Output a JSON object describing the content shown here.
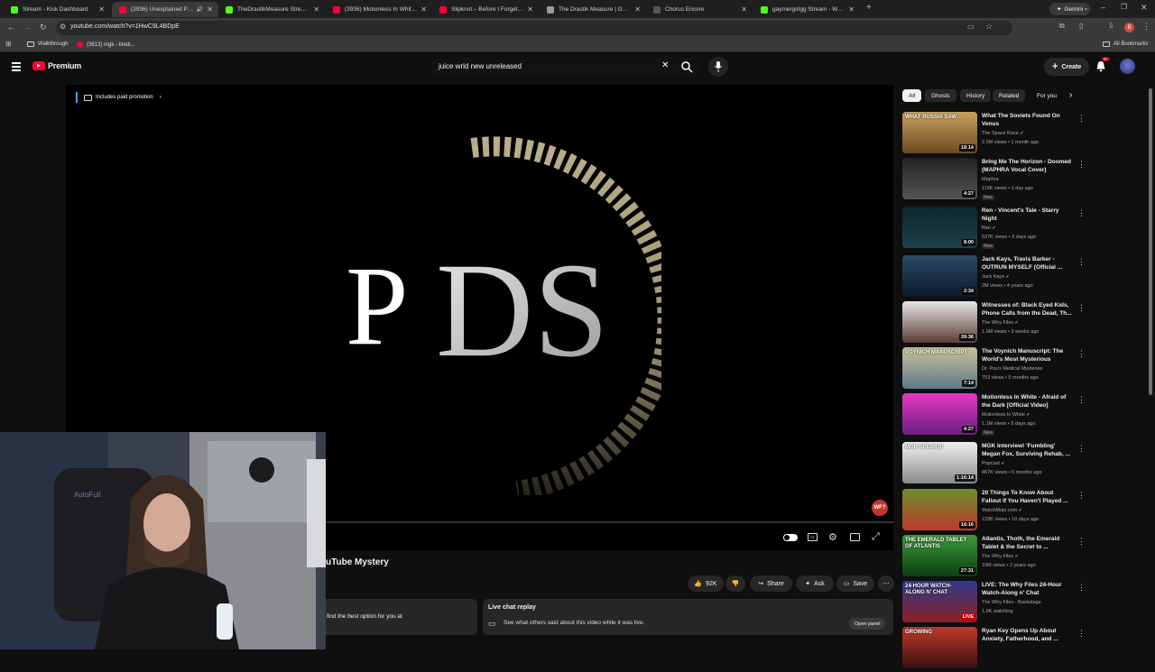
{
  "browser": {
    "tabs": [
      {
        "label": "Stream - Kick Dashboard",
        "color": "#53fc18"
      },
      {
        "label": "(3936) Unexplained Phenom",
        "color": "#ff0033",
        "active": true
      },
      {
        "label": "TheDrastikMeasure Stream - W",
        "color": "#53fc18"
      },
      {
        "label": "(3936) Motionless In White - Af",
        "color": "#ff0033"
      },
      {
        "label": "Slipknot – Before I Forget (Synt",
        "color": "#ff0033"
      },
      {
        "label": "The Drastik Measure | Gaming",
        "color": "#9a9a9a"
      },
      {
        "label": "Chorus Encore",
        "color": "#555555"
      },
      {
        "label": "gaymergirlgg Stream - Watch l",
        "color": "#53fc18"
      }
    ],
    "gemini_label": "Gemini",
    "url": "youtube.com/watch?v=1HwC9L4BDpE",
    "bookmarks": [
      {
        "label": "Walkthrough"
      },
      {
        "label": "(3813) mgk - tiredi..."
      }
    ],
    "all_bookmarks": "All Bookmarks",
    "profile_initial": "B"
  },
  "header": {
    "logo_text": "Premium",
    "search_value": "juice wrld new unreleased",
    "create_label": "Create",
    "notif_count": "9+"
  },
  "player": {
    "paid_promo": "Includes paid promotion",
    "logo_text": "PDS",
    "watermark": "WF?"
  },
  "video": {
    "title_fragment": "uTube Mystery",
    "like_count": "92K",
    "share_label": "Share",
    "ask_label": "Ask",
    "save_label": "Save",
    "promo_fragment": "find the best option for you at",
    "live_chat_title": "Live chat replay",
    "live_chat_desc": "See what others said about this video while it was live.",
    "open_panel": "Open panel"
  },
  "chips": [
    {
      "label": "All",
      "active": true
    },
    {
      "label": "Ghosts"
    },
    {
      "label": "History"
    },
    {
      "label": "Related"
    },
    {
      "label": "For you"
    }
  ],
  "recommendations": [
    {
      "title": "What The Soviets Found On Venus",
      "channel": "The Space Race",
      "meta": "2.3M views • 1 month ago",
      "duration": "18:14",
      "thumb_text": "WHAT RUSSIA SAW",
      "verified": true
    },
    {
      "title": "Bring Me The Horizon - Doomed (MAPHRA Vocal Cover)",
      "channel": "Maphra",
      "meta": "116K views • 1 day ago",
      "duration": "4:27",
      "new": "New"
    },
    {
      "title": "Ren - Vincent's Tale - Starry Night",
      "channel": "Ren",
      "meta": "537K views • 3 days ago",
      "duration": "8:00",
      "new": "New",
      "verified": true
    },
    {
      "title": "Jack Kays, Travis Barker - OUTRUN MYSELF (Official ...",
      "channel": "Jack Kays",
      "meta": "2M views • 4 years ago",
      "duration": "2:34",
      "verified": true
    },
    {
      "title": "Witnesses of: Black Eyed Kids, Phone Calls from the Dead, Th...",
      "channel": "The Why Files",
      "meta": "1.5M views • 3 weeks ago",
      "duration": "39:36",
      "verified": true
    },
    {
      "title": "The Voynich Manuscript: The World's Most Mysterious Book...",
      "channel": "Dr. Pox's Medical Mysteries",
      "meta": "753 views • 5 months ago",
      "duration": "7:14",
      "thumb_text": "VOYNICH MANUSCRIPT"
    },
    {
      "title": "Motionless In White - Afraid of the Dark [Official Video]",
      "channel": "Motionless In White",
      "meta": "1.1M views • 5 days ago",
      "duration": "4:27",
      "new": "New",
      "verified": true
    },
    {
      "title": "MGK Interview! 'Fumbling' Megan Fox, Surviving Rehab, ...",
      "channel": "Popcast",
      "meta": "467K views • 5 months ago",
      "duration": "1:16:14",
      "thumb_text": "MGK SPEAKS!",
      "verified": true
    },
    {
      "title": "20 Things To Know About Fallout If You Haven't Played ...",
      "channel": "WatchMojo.com",
      "meta": "133K views • 10 days ago",
      "duration": "16:16",
      "verified": true
    },
    {
      "title": "Atlantis, Thoth, the Emerald Tablet & the Secret to ...",
      "channel": "The Why Files",
      "meta": "10M views • 2 years ago",
      "duration": "27:31",
      "thumb_text": "THE EMERALD TABLET OF ATLANTIS",
      "verified": true
    },
    {
      "title": "LIVE: The Why Files 24-Hour Watch-Along n' Chat",
      "channel": "The Why Files - Backstage",
      "meta": "1.9K watching",
      "duration": "LIVE",
      "thumb_text": "24-HOUR WATCH-ALONG N' CHAT",
      "live": true
    },
    {
      "title": "Ryan Key Opens Up About Anxiety, Fatherhood, and ...",
      "channel": "",
      "meta": "",
      "duration": "",
      "thumb_text": "GROWING"
    }
  ]
}
